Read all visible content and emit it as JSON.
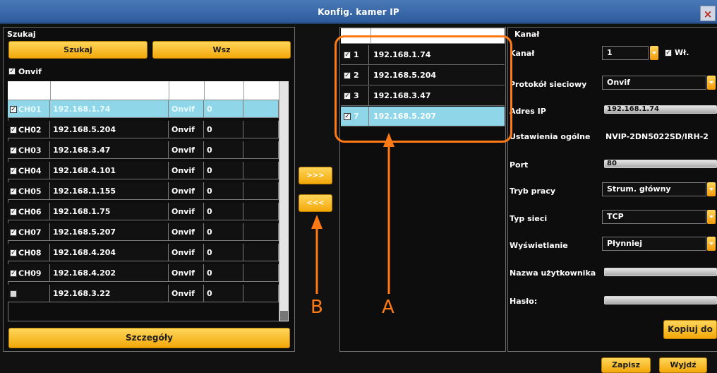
{
  "window": {
    "title": "Konfig. kamer IP",
    "close_label": "×"
  },
  "search_panel": {
    "title": "Szukaj",
    "search_button": "Szukaj",
    "all_button": "Wsz",
    "onvif_checkbox": {
      "checked": true,
      "label": "Onvif"
    },
    "rows": [
      {
        "checked": true,
        "channel": "CH01",
        "ip": "192.168.1.74",
        "protocol": "Onvif",
        "value": "0",
        "selected": true
      },
      {
        "checked": true,
        "channel": "CH02",
        "ip": "192.168.5.204",
        "protocol": "Onvif",
        "value": "0",
        "selected": false
      },
      {
        "checked": true,
        "channel": "CH03",
        "ip": "192.168.3.47",
        "protocol": "Onvif",
        "value": "0",
        "selected": false
      },
      {
        "checked": true,
        "channel": "CH04",
        "ip": "192.168.4.101",
        "protocol": "Onvif",
        "value": "0",
        "selected": false
      },
      {
        "checked": true,
        "channel": "CH05",
        "ip": "192.168.1.155",
        "protocol": "Onvif",
        "value": "0",
        "selected": false
      },
      {
        "checked": true,
        "channel": "CH06",
        "ip": "192.168.1.75",
        "protocol": "Onvif",
        "value": "0",
        "selected": false
      },
      {
        "checked": true,
        "channel": "CH07",
        "ip": "192.168.5.207",
        "protocol": "Onvif",
        "value": "0",
        "selected": false
      },
      {
        "checked": true,
        "channel": "CH08",
        "ip": "192.168.4.204",
        "protocol": "Onvif",
        "value": "0",
        "selected": false
      },
      {
        "checked": true,
        "channel": "CH09",
        "ip": "192.168.4.202",
        "protocol": "Onvif",
        "value": "0",
        "selected": false
      },
      {
        "checked": false,
        "channel": "",
        "ip": "192.168.3.22",
        "protocol": "Onvif",
        "value": "0",
        "selected": false
      }
    ],
    "details_button": "Szczegóły"
  },
  "transfer": {
    "add_label": ">>>",
    "remove_label": "<<<"
  },
  "added_list": {
    "rows": [
      {
        "checked": true,
        "index": "1",
        "ip": "192.168.1.74",
        "selected": false
      },
      {
        "checked": true,
        "index": "2",
        "ip": "192.168.5.204",
        "selected": false
      },
      {
        "checked": true,
        "index": "3",
        "ip": "192.168.3.47",
        "selected": false
      },
      {
        "checked": true,
        "index": "7",
        "ip": "192.168.5.207",
        "selected": true
      }
    ]
  },
  "channel_panel": {
    "title": "Kanał",
    "fields": {
      "channel": {
        "label": "Kanał",
        "value": "1",
        "enabled_label": "Wł.",
        "enabled": true
      },
      "protocol": {
        "label": "Protokół sieciowy",
        "value": "Onvif"
      },
      "ip": {
        "label": "Adres IP",
        "value": "192.168.1.74"
      },
      "general": {
        "label": "Ustawienia ogólne",
        "value": "NVIP-2DN5022SD/IRH-2"
      },
      "port": {
        "label": "Port",
        "value": "80"
      },
      "mode": {
        "label": "Tryb pracy",
        "value": "Strum. główny"
      },
      "network": {
        "label": "Typ sieci",
        "value": "TCP"
      },
      "display": {
        "label": "Wyświetlanie",
        "value": "Płynniej"
      },
      "username": {
        "label": "Nazwa użytkownika",
        "value": ""
      },
      "password": {
        "label": "Hasło:",
        "value": ""
      }
    },
    "copy_button": "Kopiuj do"
  },
  "footer": {
    "save_button": "Zapisz",
    "exit_button": "Wyjdź"
  },
  "annotations": {
    "a": "A",
    "b": "B"
  },
  "colors": {
    "accent": "#f3a80a",
    "selection": "#8ed6e8",
    "annotation": "#ff7a14"
  }
}
